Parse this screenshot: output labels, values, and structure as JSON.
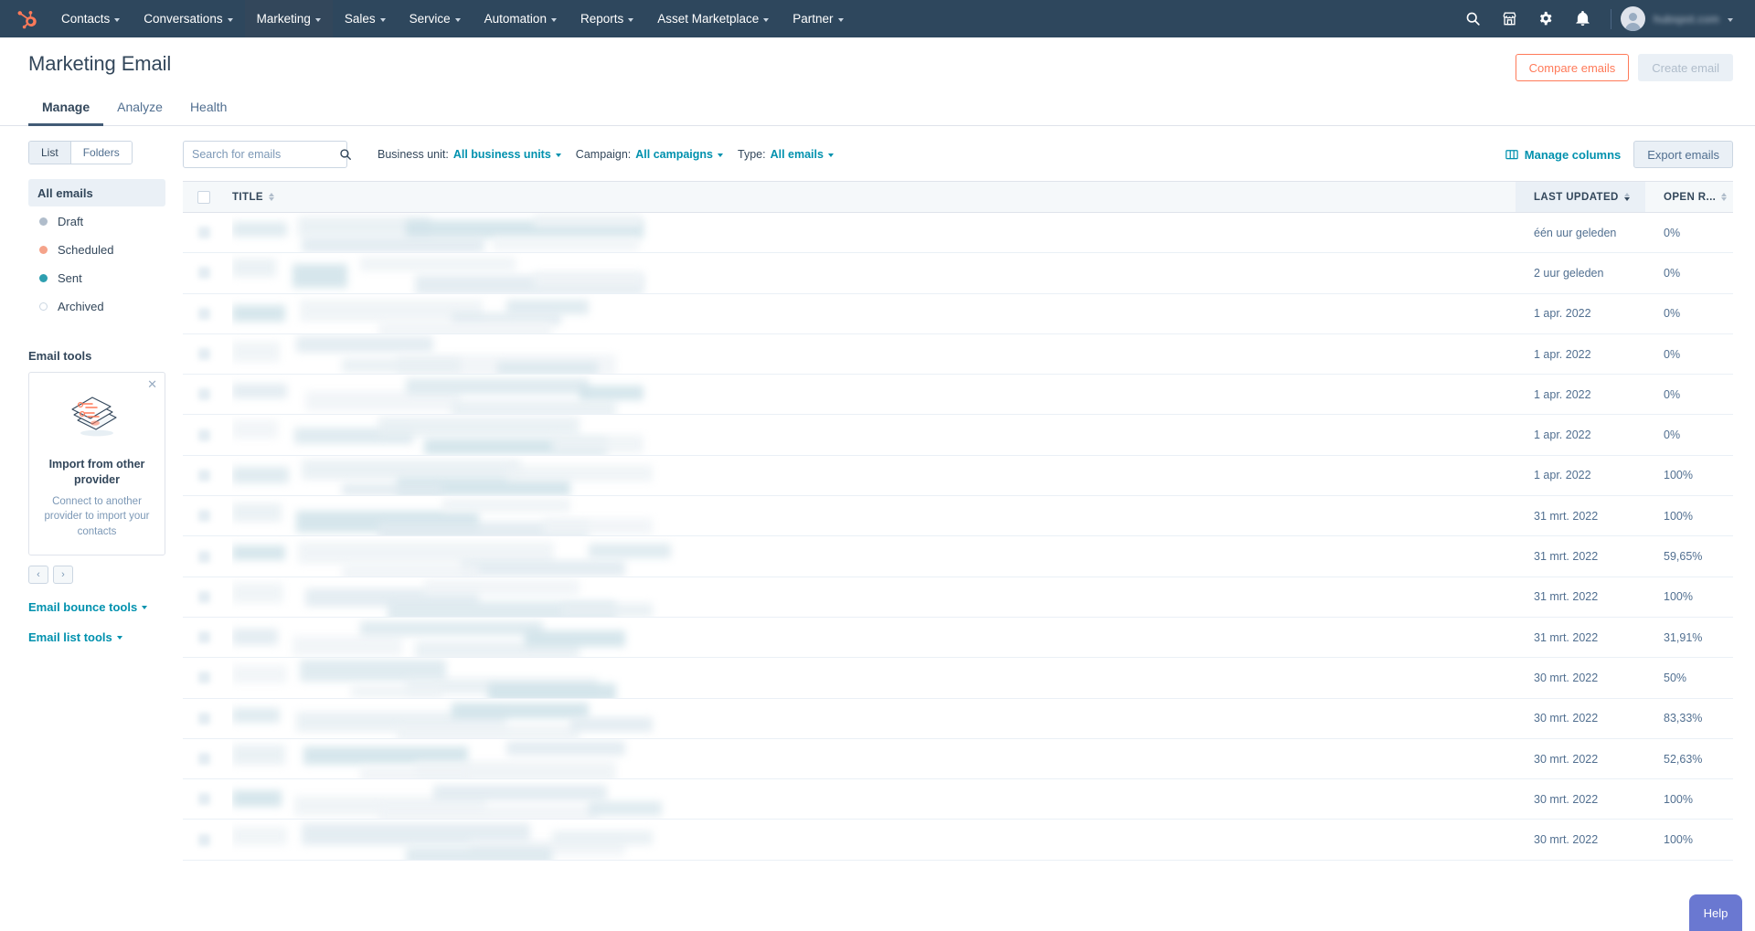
{
  "topnav": {
    "logo": "hubspot-sprocket-logo",
    "items": [
      {
        "label": "Contacts",
        "has_caret": true,
        "active": false
      },
      {
        "label": "Conversations",
        "has_caret": true,
        "active": false
      },
      {
        "label": "Marketing",
        "has_caret": true,
        "active": true
      },
      {
        "label": "Sales",
        "has_caret": true,
        "active": false
      },
      {
        "label": "Service",
        "has_caret": true,
        "active": false
      },
      {
        "label": "Automation",
        "has_caret": true,
        "active": false
      },
      {
        "label": "Reports",
        "has_caret": true,
        "active": false
      },
      {
        "label": "Asset Marketplace",
        "has_caret": true,
        "active": false
      },
      {
        "label": "Partner",
        "has_caret": true,
        "active": false
      }
    ],
    "icons": [
      "search-icon",
      "marketplace-icon",
      "settings-gear-icon",
      "notifications-bell-icon"
    ],
    "account_name": "hubspot.com",
    "bg_color": "#2e475d"
  },
  "header": {
    "title": "Marketing Email",
    "compare_label": "Compare emails",
    "create_label": "Create email",
    "tabs": [
      {
        "label": "Manage",
        "active": true
      },
      {
        "label": "Analyze",
        "active": false
      },
      {
        "label": "Health",
        "active": false
      }
    ]
  },
  "sidebar": {
    "view_toggle": [
      {
        "label": "List",
        "active": true
      },
      {
        "label": "Folders",
        "active": false
      }
    ],
    "items": [
      {
        "label": "All emails",
        "dot": "none",
        "selected": true
      },
      {
        "label": "Draft",
        "dot": "draft",
        "selected": false
      },
      {
        "label": "Scheduled",
        "dot": "scheduled",
        "selected": false
      },
      {
        "label": "Sent",
        "dot": "sent",
        "selected": false
      },
      {
        "label": "Archived",
        "dot": "archived",
        "selected": false
      }
    ],
    "tools_heading": "Email tools",
    "card": {
      "title": "Import from other provider",
      "description": "Connect to another provider to import your contacts",
      "close_icon": "close-icon",
      "prev_icon": "‹",
      "next_icon": "›"
    },
    "links": [
      {
        "label": "Email bounce tools"
      },
      {
        "label": "Email list tools"
      }
    ]
  },
  "toolbar": {
    "search_placeholder": "Search for emails",
    "search_value": "",
    "filters": [
      {
        "label": "Business unit:",
        "value": "All business units"
      },
      {
        "label": "Campaign:",
        "value": "All campaigns"
      },
      {
        "label": "Type:",
        "value": "All emails"
      }
    ],
    "manage_columns_label": "Manage columns",
    "export_label": "Export emails"
  },
  "table": {
    "columns": [
      {
        "key": "title",
        "label": "TITLE",
        "sorted": false
      },
      {
        "key": "last_updated",
        "label": "LAST UPDATED",
        "sorted": true,
        "direction": "desc"
      },
      {
        "key": "open_rate",
        "label": "OPEN R...",
        "sorted": false
      }
    ],
    "rows": [
      {
        "title": "",
        "last_updated": "één uur geleden",
        "open_rate": "0%"
      },
      {
        "title": "",
        "last_updated": "2 uur geleden",
        "open_rate": "0%"
      },
      {
        "title": "",
        "last_updated": "1 apr. 2022",
        "open_rate": "0%"
      },
      {
        "title": "",
        "last_updated": "1 apr. 2022",
        "open_rate": "0%"
      },
      {
        "title": "",
        "last_updated": "1 apr. 2022",
        "open_rate": "0%"
      },
      {
        "title": "",
        "last_updated": "1 apr. 2022",
        "open_rate": "0%"
      },
      {
        "title": "",
        "last_updated": "1 apr. 2022",
        "open_rate": "100%"
      },
      {
        "title": "",
        "last_updated": "31 mrt. 2022",
        "open_rate": "100%"
      },
      {
        "title": "",
        "last_updated": "31 mrt. 2022",
        "open_rate": "59,65%"
      },
      {
        "title": "",
        "last_updated": "31 mrt. 2022",
        "open_rate": "100%"
      },
      {
        "title": "",
        "last_updated": "31 mrt. 2022",
        "open_rate": "31,91%"
      },
      {
        "title": "",
        "last_updated": "30 mrt. 2022",
        "open_rate": "50%"
      },
      {
        "title": "",
        "last_updated": "30 mrt. 2022",
        "open_rate": "83,33%"
      },
      {
        "title": "",
        "last_updated": "30 mrt. 2022",
        "open_rate": "52,63%"
      },
      {
        "title": "",
        "last_updated": "30 mrt. 2022",
        "open_rate": "100%"
      },
      {
        "title": "",
        "last_updated": "30 mrt. 2022",
        "open_rate": "100%"
      }
    ]
  },
  "help": {
    "label": "Help",
    "color": "#6a78d1"
  },
  "colors": {
    "nav_bg": "#2e475d",
    "accent_orange": "#ff7a59",
    "link_teal": "#0091ae",
    "text_dark": "#33475b",
    "text_muted": "#516f90",
    "border": "#dfe3eb",
    "row_hover": "#f5f8fa"
  }
}
